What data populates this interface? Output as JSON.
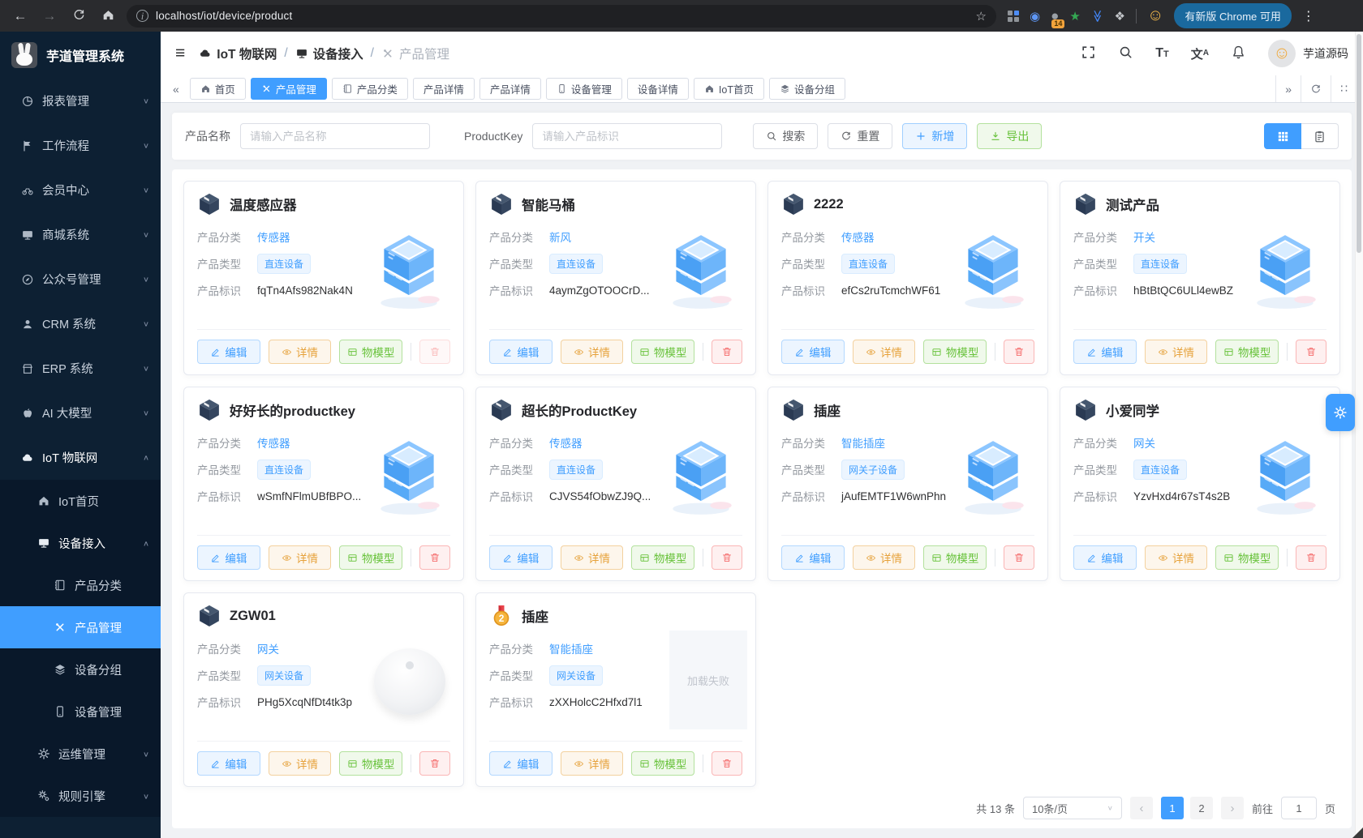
{
  "browser": {
    "url": "localhost/iot/device/product",
    "update_chip": "有新版 Chrome 可用",
    "ext_badge": "14"
  },
  "sidebar": {
    "title": "芋道管理系统",
    "menu": [
      {
        "id": "report",
        "label": "报表管理",
        "icon": "pie",
        "chevron": "down"
      },
      {
        "id": "workflow",
        "label": "工作流程",
        "icon": "flag",
        "chevron": "down"
      },
      {
        "id": "member",
        "label": "会员中心",
        "icon": "bike",
        "chevron": "down"
      },
      {
        "id": "mall",
        "label": "商城系统",
        "icon": "monitor",
        "chevron": "down"
      },
      {
        "id": "official-account",
        "label": "公众号管理",
        "icon": "compass",
        "chevron": "down"
      },
      {
        "id": "crm",
        "label": "CRM 系统",
        "icon": "user",
        "chevron": "down"
      },
      {
        "id": "erp",
        "label": "ERP 系统",
        "icon": "shop",
        "chevron": "down"
      },
      {
        "id": "ai",
        "label": "AI 大模型",
        "icon": "apple",
        "chevron": "down"
      },
      {
        "id": "iot",
        "label": "IoT 物联网",
        "icon": "cloud",
        "chevron": "up",
        "open": true,
        "children": [
          {
            "id": "iot-home",
            "label": "IoT首页",
            "icon": "home"
          },
          {
            "id": "device-access",
            "label": "设备接入",
            "icon": "monitor",
            "chevron": "up",
            "open": true,
            "children": [
              {
                "id": "product-category",
                "label": "产品分类",
                "icon": "book"
              },
              {
                "id": "product-management",
                "label": "产品管理",
                "icon": "tools",
                "active": true
              },
              {
                "id": "device-group",
                "label": "设备分组",
                "icon": "layers"
              },
              {
                "id": "device-management",
                "label": "设备管理",
                "icon": "phone"
              }
            ]
          },
          {
            "id": "ops",
            "label": "运维管理",
            "icon": "gear",
            "chevron": "down"
          },
          {
            "id": "rule-engine",
            "label": "规则引擎",
            "icon": "gears",
            "chevron": "down"
          }
        ]
      }
    ]
  },
  "header": {
    "breadcrumb": [
      {
        "label": "IoT 物联网",
        "icon": "cloud"
      },
      {
        "label": "设备接入",
        "icon": "monitor"
      },
      {
        "label": "产品管理",
        "icon": "tools",
        "current": true
      }
    ],
    "username": "芋道源码"
  },
  "tabs": [
    {
      "id": "home",
      "label": "首页",
      "icon": "home"
    },
    {
      "id": "product-management",
      "label": "产品管理",
      "icon": "tools",
      "active": true
    },
    {
      "id": "product-category",
      "label": "产品分类",
      "icon": "book"
    },
    {
      "id": "product-detail-1",
      "label": "产品详情"
    },
    {
      "id": "product-detail-2",
      "label": "产品详情"
    },
    {
      "id": "device-management",
      "label": "设备管理",
      "icon": "phone"
    },
    {
      "id": "device-detail",
      "label": "设备详情"
    },
    {
      "id": "iot-home",
      "label": "IoT首页",
      "icon": "home"
    },
    {
      "id": "device-group",
      "label": "设备分组",
      "icon": "layers"
    }
  ],
  "filter": {
    "name_label": "产品名称",
    "name_placeholder": "请输入产品名称",
    "key_label": "ProductKey",
    "key_placeholder": "请输入产品标识",
    "search": "搜索",
    "reset": "重置",
    "add": "新增",
    "export": "导出"
  },
  "card_labels": {
    "category": "产品分类",
    "type": "产品类型",
    "key": "产品标识"
  },
  "actions": {
    "edit": "编辑",
    "detail": "详情",
    "model": "物模型"
  },
  "misc": {
    "load_failed": "加载失败"
  },
  "products": [
    {
      "name": "温度感应器",
      "category": "传感器",
      "type": "直连设备",
      "key": "fqTn4Afs982Nak4N",
      "image": "cube",
      "icon": "cube",
      "delete_disabled": true
    },
    {
      "name": "智能马桶",
      "category": "新风",
      "type": "直连设备",
      "key": "4aymZgOTOOCrD...",
      "image": "cube",
      "icon": "cube"
    },
    {
      "name": "2222",
      "category": "传感器",
      "type": "直连设备",
      "key": "efCs2ruTcmchWF61",
      "image": "cube",
      "icon": "cube"
    },
    {
      "name": "测试产品",
      "category": "开关",
      "type": "直连设备",
      "key": "hBtBtQC6ULl4ewBZ",
      "image": "cube",
      "icon": "cube"
    },
    {
      "name": "好好长的productkey",
      "category": "传感器",
      "type": "直连设备",
      "key": "wSmfNFlmUBfBPO...",
      "image": "cube",
      "icon": "cube"
    },
    {
      "name": "超长的ProductKey",
      "category": "传感器",
      "type": "直连设备",
      "key": "CJVS54fObwZJ9Q...",
      "image": "cube",
      "icon": "cube"
    },
    {
      "name": "插座",
      "category": "智能插座",
      "type": "网关子设备",
      "key": "jAufEMTF1W6wnPhn",
      "image": "cube",
      "icon": "cube"
    },
    {
      "name": "小爱同学",
      "category": "网关",
      "type": "直连设备",
      "key": "YzvHxd4r67sT4s2B",
      "image": "cube",
      "icon": "cube"
    },
    {
      "name": "ZGW01",
      "category": "网关",
      "type": "网关设备",
      "key": "PHg5XcqNfDt4tk3p",
      "image": "photo",
      "icon": "cube"
    },
    {
      "name": "插座",
      "category": "智能插座",
      "type": "网关设备",
      "key": "zXXHolcC2Hfxd7l1",
      "image": "failed",
      "icon": "medal"
    }
  ],
  "pagination": {
    "total": "共 13 条",
    "page_size": "10条/页",
    "pages": [
      "1",
      "2"
    ],
    "active_page": "1",
    "goto_label": "前往",
    "goto_value": "1",
    "unit_label": "页"
  },
  "colors": {
    "primary": "#409eff",
    "success": "#67c23a",
    "warning": "#e6a23c",
    "danger": "#f56c6c",
    "sidebar_bg": "#0d2033"
  },
  "icons": {
    "back": "←",
    "forward": "→",
    "hamburger": "≡",
    "star": "☆",
    "dots": "⋮",
    "smiley": "☺",
    "chevron-down": "∨",
    "chevron-up": "∧",
    "collapse": "«",
    "expand": "»",
    "tab-grid": "∷",
    "grid-view": "▦",
    "list-view": "▤",
    "pager-prev": "‹",
    "pager-next": "›",
    "puzzle": "❖",
    "diamond": "◆",
    "balloon": "◉",
    "green-star": "★",
    "double-chevron": "≫",
    "circle": "●"
  }
}
